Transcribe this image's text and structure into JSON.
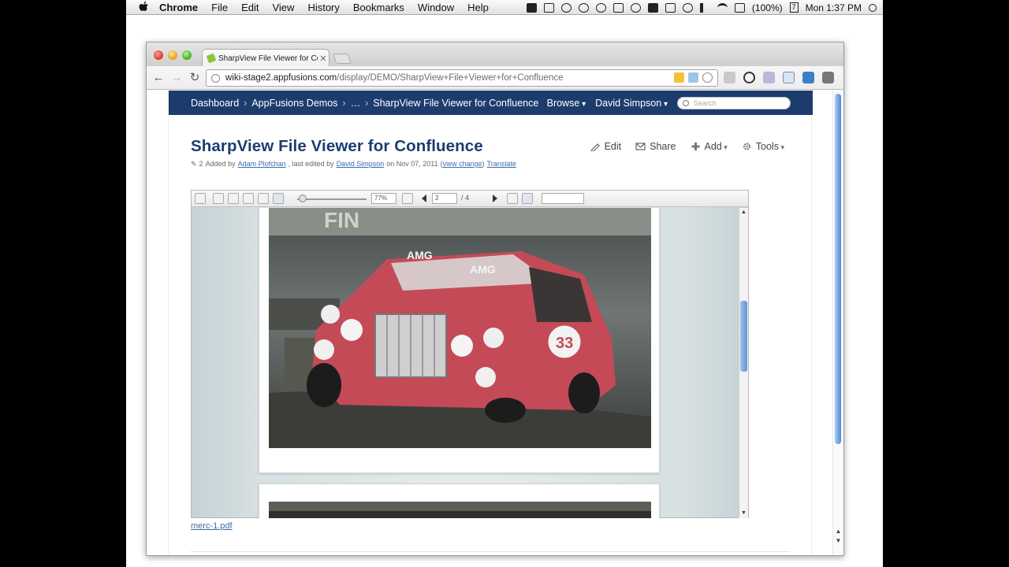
{
  "menubar": {
    "items": [
      "Chrome",
      "File",
      "Edit",
      "View",
      "History",
      "Bookmarks",
      "Window",
      "Help"
    ],
    "battery": "(100%)",
    "calendar_day": "7",
    "clock": "Mon 1:37 PM"
  },
  "browser": {
    "tab_title": "SharpView File Viewer for Co",
    "url_host": "wiki-stage2.appfusions.com",
    "url_path": "/display/DEMO/SharpView+File+Viewer+for+Confluence"
  },
  "header": {
    "crumbs": [
      "Dashboard",
      "AppFusions Demos",
      "…",
      "SharpView File Viewer for Confluence"
    ],
    "browse": "Browse",
    "user": "David Simpson",
    "search_placeholder": "Search"
  },
  "page": {
    "title": "SharpView File Viewer for Confluence",
    "actions": {
      "edit": "Edit",
      "share": "Share",
      "add": "Add",
      "tools": "Tools"
    },
    "meta": {
      "count": "2",
      "added_by_prefix": "Added by",
      "author": "Adam Plofchan",
      "edited_prefix": ", last edited by",
      "editor": "David Simpson",
      "date": "on Nov 07, 2011",
      "view_change": "view change",
      "translate": "Translate"
    }
  },
  "viewer": {
    "zoom": "77%",
    "page_current": "2",
    "page_total": "/ 4",
    "find_value": ""
  },
  "attachment": {
    "filename": "merc-1.pdf"
  },
  "colors": {
    "header_bg": "#1d3c6e",
    "title": "#1b3e70",
    "link": "#3b6da8"
  }
}
